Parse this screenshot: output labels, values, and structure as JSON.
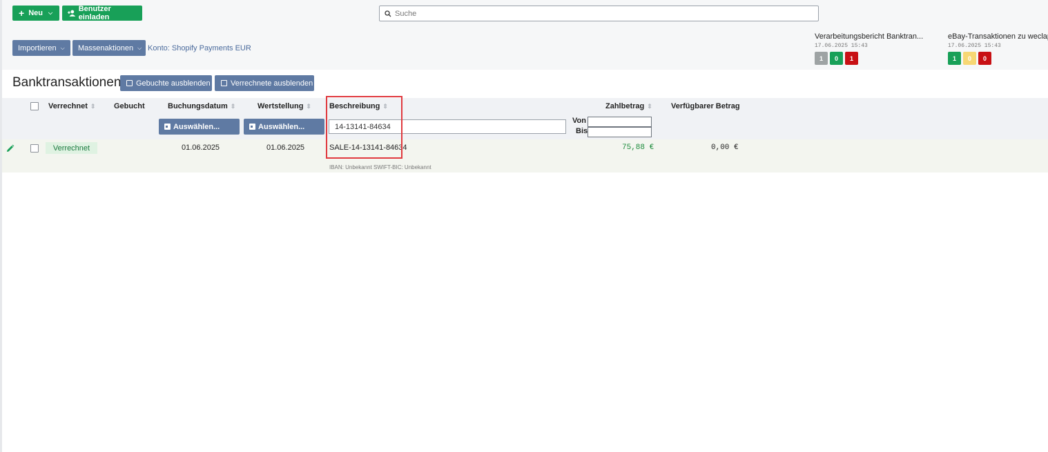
{
  "toolbar": {
    "new_label": "Neu",
    "invite_label": "Benutzer einladen",
    "search_placeholder": "Suche",
    "import_label": "Importieren",
    "mass_label": "Massenaktionen",
    "konto_label": "Konto: Shopify Payments EUR"
  },
  "reports": [
    {
      "title": "Verarbeitungsbericht Banktran...",
      "timestamp": "17.06.2025 15:43",
      "badges": [
        {
          "value": "1",
          "color": "#9ea3a4"
        },
        {
          "value": "0",
          "color": "#18a058"
        },
        {
          "value": "1",
          "color": "#c81014"
        }
      ]
    },
    {
      "title": "eBay-Transaktionen zu weclapp",
      "timestamp": "17.06.2025 15:43",
      "badges": [
        {
          "value": "1",
          "color": "#18a058"
        },
        {
          "value": "0",
          "color": "#f7d774"
        },
        {
          "value": "0",
          "color": "#c81014"
        }
      ]
    }
  ],
  "page": {
    "title": "Banktransaktionen",
    "hide_booked": "Gebuchte ausblenden",
    "hide_settled": "Verrechnete ausblenden"
  },
  "table": {
    "columns": {
      "settled": "Verrechnet",
      "booked": "Gebucht",
      "booking_date": "Buchungsdatum",
      "value_date": "Wertstellung",
      "description": "Beschreibung",
      "amount": "Zahlbetrag",
      "available": "Verfügbarer Betrag"
    },
    "filters": {
      "booking_date_btn": "Auswählen...",
      "value_date_btn": "Auswählen...",
      "description_value": "14-13141-84634",
      "from_label": "Von",
      "to_label": "Bis"
    },
    "rows": [
      {
        "status": "Verrechnet",
        "booking_date": "01.06.2025",
        "value_date": "01.06.2025",
        "description": "SALE-14-13141-84634",
        "iban_info": "IBAN: Unbekannt SWIFT-BIC: Unbekannt",
        "amount": "75,88 €",
        "available": "0,00 €"
      }
    ]
  },
  "colors": {
    "green": "#18a058",
    "blue": "#5f7aa3",
    "amount_green": "#1a8a3a",
    "highlight": "#e0393e"
  }
}
